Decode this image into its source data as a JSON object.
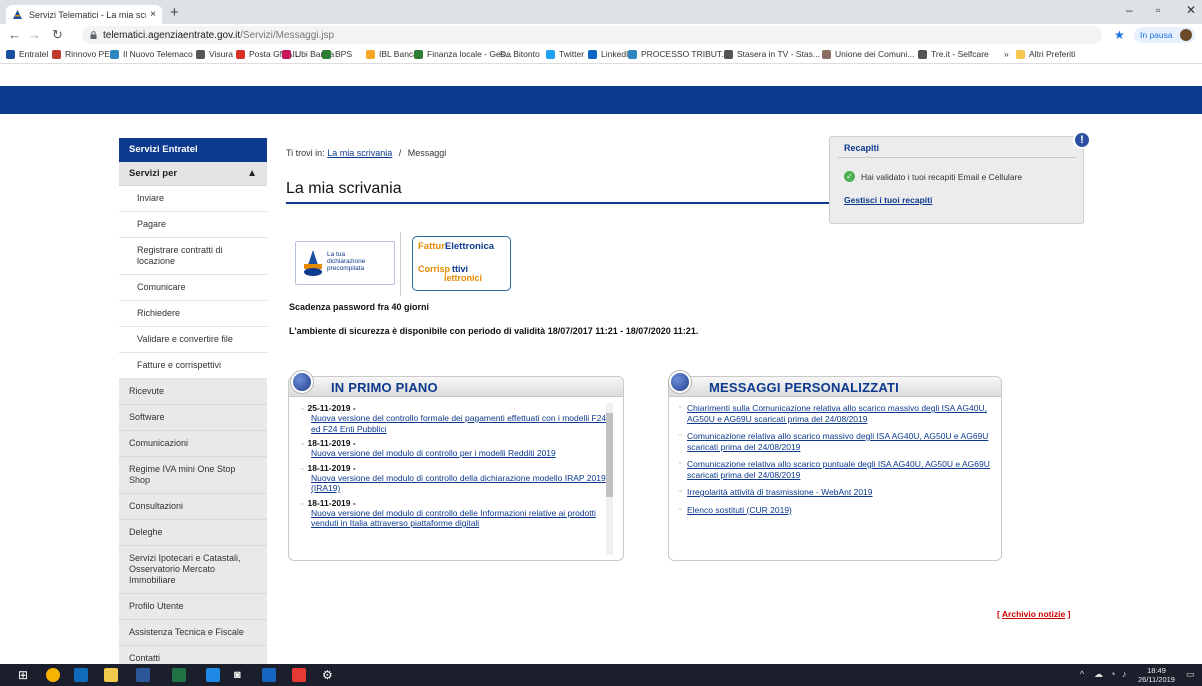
{
  "browser": {
    "tab_title": "Servizi Telematici - La mia scrivan",
    "tab_close": "×",
    "new_tab": "+",
    "url_host": "telematici.agenziaentrate.gov.it",
    "url_path": "/Servizi/Messaggi.jsp",
    "profile_label": "In pausa",
    "window_minimize": "–",
    "window_maximize": "▫",
    "window_close": "✕",
    "bookmarks": [
      {
        "label": "Entratel",
        "color": "#1a4fa0"
      },
      {
        "label": "Rinnovo PEC",
        "color": "#c0392b"
      },
      {
        "label": "Il Nuovo Telemaco",
        "color": "#2e86c1"
      },
      {
        "label": "Visura",
        "color": "#555555"
      },
      {
        "label": "Posta GMAIL",
        "color": "#d93025"
      },
      {
        "label": "Ubi Banca",
        "color": "#c2185b"
      },
      {
        "label": "BPS",
        "color": "#2e7d32"
      },
      {
        "label": "IBL Banca",
        "color": "#f9a825"
      },
      {
        "label": "Finanza locale - Ges...",
        "color": "#2e7d32"
      },
      {
        "label": "Da Bitonto",
        "color": "#ffffff"
      },
      {
        "label": "Twitter",
        "color": "#1da1f2"
      },
      {
        "label": "LinkedIn",
        "color": "#0a66c2"
      },
      {
        "label": "PROCESSO TRIBUT...",
        "color": "#2e86c1"
      },
      {
        "label": "Stasera in TV - Stas...",
        "color": "#555555"
      },
      {
        "label": "Unione dei Comuni...",
        "color": "#8d6e63"
      },
      {
        "label": "Tre.it - Selfcare",
        "color": "#555555"
      },
      {
        "label": "»",
        "color": "#ffffff"
      },
      {
        "label": "Altri Preferiti",
        "color": "#f9c74f"
      }
    ]
  },
  "sidebar": {
    "header": "Servizi Entratel",
    "section": "Servizi per",
    "section_chevron": "▲",
    "sub_items": [
      "Inviare",
      "Pagare",
      "Registrare contratti di locazione",
      "Comunicare",
      "Richiedere",
      "Validare e convertire file",
      "Fatture e corrispettivi"
    ],
    "top_items": [
      "Ricevute",
      "Software",
      "Comunicazioni",
      "Regime IVA mini One Stop Shop",
      "Consultazioni",
      "Deleghe",
      "Servizi Ipotecari e Catastali, Osservatorio Mercato Immobiliare",
      "Profilo Utente",
      "Assistenza Tecnica e Fiscale",
      "Contatti"
    ]
  },
  "breadcrumb": {
    "prefix": "Ti trovi in:",
    "link": "La mia scrivania",
    "separator": "/",
    "current": "Messaggi"
  },
  "page_title": "La mia scrivania",
  "recapiti": {
    "title": "Recapiti",
    "alert": "!",
    "message": "Hai validato i tuoi recapiti Email e Cellulare",
    "link": "Gestisci i tuoi recapiti"
  },
  "banners": {
    "dichiarazione": [
      "La tua",
      "dichiarazione",
      "precompilata"
    ],
    "fattura_pre": "Fattur",
    "fattura_post": "Elettronica",
    "corrisp": [
      "Corrisp",
      "ttivi",
      "lettronici"
    ]
  },
  "notes": {
    "password": "Scadenza password fra 40 giorni",
    "security": "L'ambiente di sicurezza è disponibile con periodo di validità 18/07/2017 11:21 - 18/07/2020 11:21."
  },
  "in_primo_piano": {
    "title": "IN PRIMO PIANO",
    "items": [
      {
        "date": "25-11-2019 -",
        "text": "Nuova versione del controllo formale dei pagamenti effettuati con i modelli F24 ed F24 Enti Pubblici"
      },
      {
        "date": "18-11-2019 -",
        "text": "Nuova versione del modulo di controllo per i modelli Redditi 2019"
      },
      {
        "date": "18-11-2019 -",
        "text": "Nuova versione del modulo di controllo della dichiarazione modello IRAP 2019 (IRA19)"
      },
      {
        "date": "18-11-2019 -",
        "text": "Nuova versione del modulo di controllo delle Informazioni relative ai prodotti venduti in Italia attraverso piattaforme digitali"
      }
    ]
  },
  "messaggi": {
    "title": "MESSAGGI PERSONALIZZATI",
    "items": [
      "Chiarimenti sulla Comunicazione relativa allo scarico massivo degli ISA AG40U, AG50U e AG69U scaricati prima del 24/08/2019",
      "Comunicazione relativa allo scarico massivo degli ISA AG40U, AG50U e AG69U scaricati prima del 24/08/2019",
      "Comunicazione relativa allo scarico puntuale degli ISA AG40U, AG50U e AG69U scaricati prima del 24/08/2019",
      "Irregolarità attività di trasmissione - WebAnt 2019",
      "Elenco sostituti (CUR 2019)"
    ]
  },
  "archivio": {
    "open": "[",
    "link": "Archivio notizie",
    "close": "]"
  },
  "taskbar": {
    "time": "18:49",
    "date": "26/11/2019",
    "apps": [
      {
        "name": "windows-start-icon",
        "color": "#ffffff"
      },
      {
        "name": "chrome-icon",
        "color": "#f4b400"
      },
      {
        "name": "outlook-icon",
        "color": "#0f6cbd"
      },
      {
        "name": "file-explorer-icon",
        "color": "#f2c94c"
      },
      {
        "name": "word-icon",
        "color": "#2b579a"
      },
      {
        "name": "excel-icon",
        "color": "#217346"
      },
      {
        "name": "app-l-icon",
        "color": "#1e88e5"
      },
      {
        "name": "camera-icon",
        "color": "#ffffff"
      },
      {
        "name": "app-blue-icon",
        "color": "#1565c0"
      },
      {
        "name": "paint-icon",
        "color": "#e53935"
      },
      {
        "name": "settings-icon",
        "color": "#ffffff"
      }
    ]
  }
}
